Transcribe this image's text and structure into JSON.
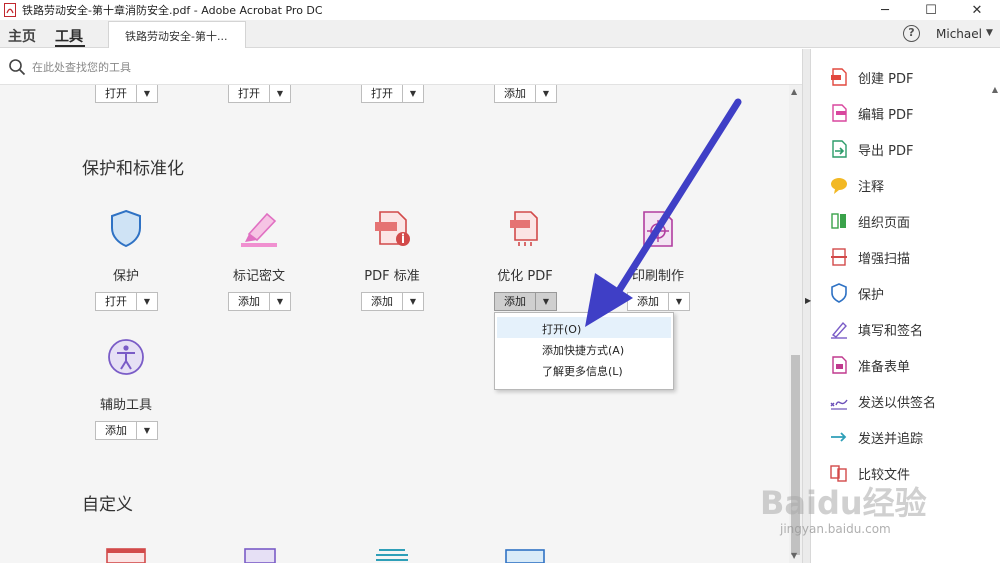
{
  "window": {
    "title": "铁路劳动安全-第十章消防安全.pdf - Adobe Acrobat Pro DC",
    "minimize": "─",
    "maximize": "☐",
    "close": "✕"
  },
  "menubar": {
    "home": "主页",
    "tools": "工具",
    "doc_tab": "铁路劳动安全-第十...",
    "help": "?",
    "user": "Michael"
  },
  "search": {
    "placeholder": "在此处查找您的工具"
  },
  "top_row_buttons": [
    "打开",
    "打开",
    "打开",
    "添加"
  ],
  "sections": {
    "protect_title": "保护和标准化",
    "custom_title": "自定义"
  },
  "tools": [
    {
      "label": "保护",
      "button": "打开",
      "icon": "shield-icon"
    },
    {
      "label": "标记密文",
      "button": "添加",
      "icon": "redact-marker-icon"
    },
    {
      "label": "PDF 标准",
      "button": "添加",
      "icon": "pdf-standards-icon"
    },
    {
      "label": "优化 PDF",
      "button": "添加",
      "icon": "optimize-pdf-icon"
    },
    {
      "label": "印刷制作",
      "button": "添加",
      "icon": "print-production-icon"
    },
    {
      "label": "辅助工具",
      "button": "添加",
      "icon": "accessibility-icon"
    }
  ],
  "dropdown": {
    "items": [
      "打开(O)",
      "添加快捷方式(A)",
      "了解更多信息(L)"
    ],
    "highlighted_index": 0
  },
  "right_pane": {
    "items": [
      {
        "label": "创建 PDF",
        "icon": "create-pdf-icon",
        "color": "#e2483e"
      },
      {
        "label": "编辑 PDF",
        "icon": "edit-pdf-icon",
        "color": "#d9469e"
      },
      {
        "label": "导出 PDF",
        "icon": "export-pdf-icon",
        "color": "#2c9c6a"
      },
      {
        "label": "注释",
        "icon": "comment-icon",
        "color": "#f2b824"
      },
      {
        "label": "组织页面",
        "icon": "organize-pages-icon",
        "color": "#3aa24a"
      },
      {
        "label": "增强扫描",
        "icon": "enhance-scan-icon",
        "color": "#d24a4a"
      },
      {
        "label": "保护",
        "icon": "protect-icon",
        "color": "#2f72c4"
      },
      {
        "label": "填写和签名",
        "icon": "fill-sign-icon",
        "color": "#7a5cc7"
      },
      {
        "label": "准备表单",
        "icon": "prepare-form-icon",
        "color": "#c0398e"
      },
      {
        "label": "发送以供签名",
        "icon": "send-for-signature-icon",
        "color": "#6b4fb8"
      },
      {
        "label": "发送并追踪",
        "icon": "send-track-icon",
        "color": "#2e9fb8"
      },
      {
        "label": "比较文件",
        "icon": "compare-files-icon",
        "color": "#d24a4a"
      }
    ]
  },
  "watermark": {
    "logo": "Baidu经验",
    "url": "jingyan.baidu.com"
  },
  "colors": {
    "arrow": "#3f3fc6",
    "panel_bg": "#f5f5f5"
  }
}
